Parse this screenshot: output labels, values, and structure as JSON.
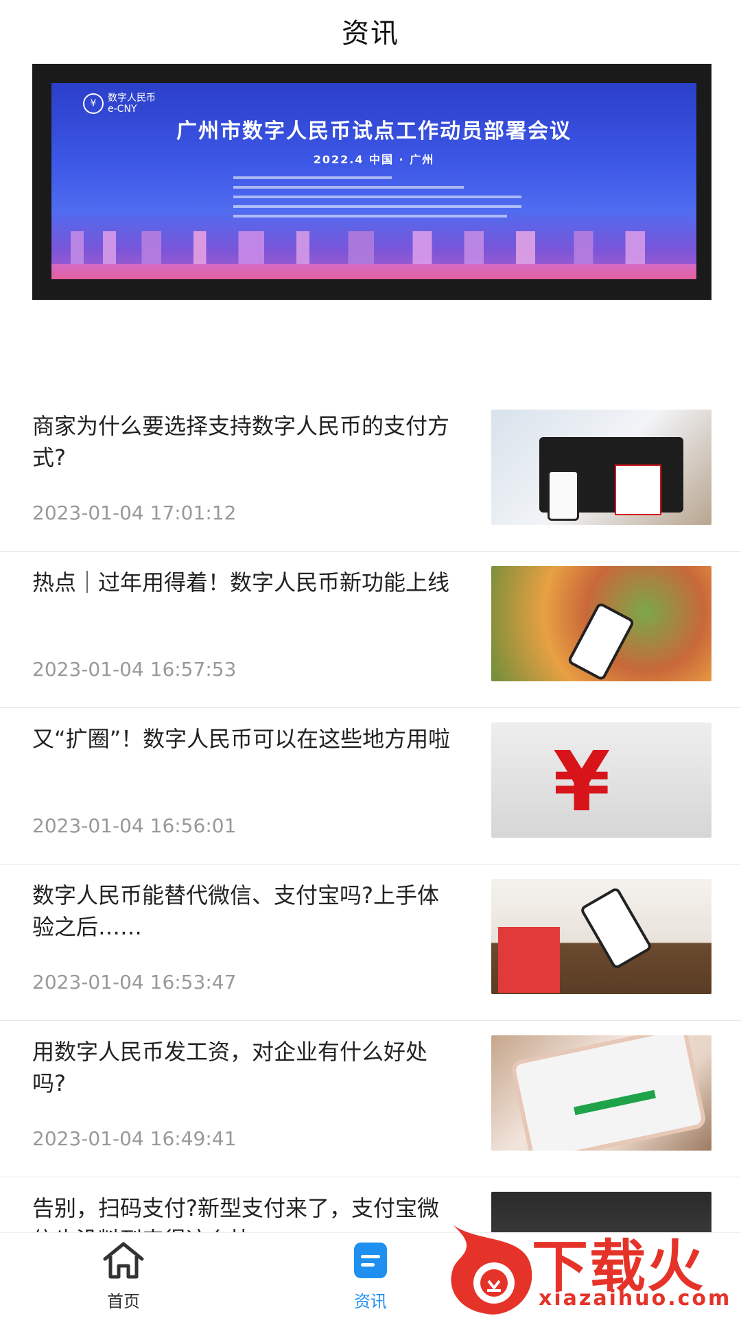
{
  "header": {
    "title": "资讯"
  },
  "banner": {
    "logo_cn": "数字人民币",
    "logo_en": "e-CNY",
    "title": "广州市数字人民币试点工作动员部署会议",
    "subtitle": "2022.4    中国 · 广州"
  },
  "news": [
    {
      "title": "商家为什么要选择支持数字人民币的支付方式?",
      "time": "2023-01-04 17:01:12",
      "thumb_icon": "payment-terminal-photo"
    },
    {
      "title": "热点｜过年用得着！数字人民币新功能上线",
      "time": "2023-01-04 16:57:53",
      "thumb_icon": "phone-payment-market-photo"
    },
    {
      "title": "又“扩圈”！数字人民币可以在这些地方用啦",
      "time": "2023-01-04 16:56:01",
      "thumb_icon": "yen-symbol-photo"
    },
    {
      "title": "数字人民币能替代微信、支付宝吗?上手体验之后……",
      "time": "2023-01-04 16:53:47",
      "thumb_icon": "phone-tap-pay-photo"
    },
    {
      "title": "用数字人民币发工资，对企业有什么好处吗?",
      "time": "2023-01-04 16:49:41",
      "thumb_icon": "phone-screen-photo"
    },
    {
      "title": "告别，扫码支付?新型支付来了，支付宝微信也没料到来得这么快",
      "time": "",
      "thumb_icon": "counter-photo"
    }
  ],
  "bottom_nav": [
    {
      "label": "首页",
      "icon": "home-icon",
      "active": false
    },
    {
      "label": "资讯",
      "icon": "news-icon",
      "active": true
    }
  ],
  "watermark": {
    "text": "下载火",
    "url": "xiazaihuo.com"
  },
  "colors": {
    "active": "#1f8ff0",
    "muted": "#999999",
    "brand_red": "#e5332a"
  }
}
